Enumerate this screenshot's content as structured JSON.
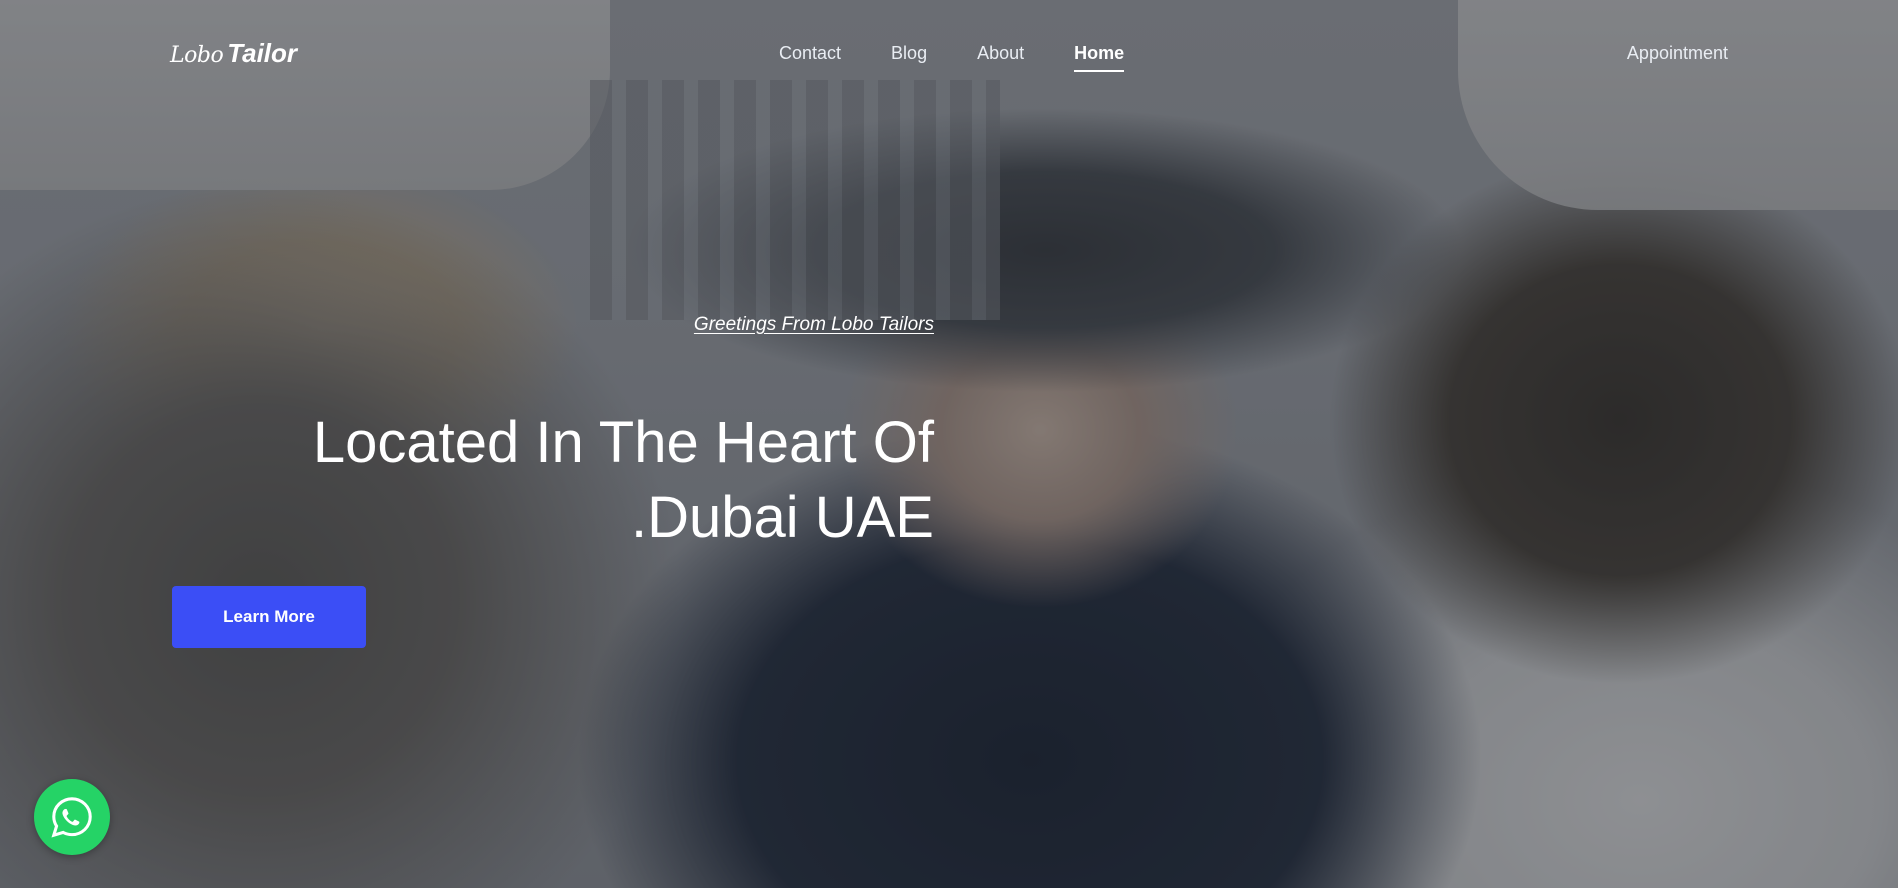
{
  "brand": {
    "logo_script": "Lobo",
    "logo_word": "Tailor"
  },
  "nav": {
    "items": [
      {
        "label": "Contact",
        "active": false
      },
      {
        "label": "Blog",
        "active": false
      },
      {
        "label": "About",
        "active": false
      },
      {
        "label": "Home",
        "active": true
      }
    ],
    "appointment_label": "Appointment"
  },
  "hero": {
    "greeting": "Greetings From Lobo Tailors",
    "headline_line1": "Located In The Heart Of",
    "headline_line2": ".Dubai UAE",
    "cta_label": "Learn More"
  },
  "floating": {
    "whatsapp_icon": "whatsapp-icon",
    "accent_color": "#25d366"
  },
  "colors": {
    "cta": "#3b4ef6",
    "text": "#ffffff"
  }
}
